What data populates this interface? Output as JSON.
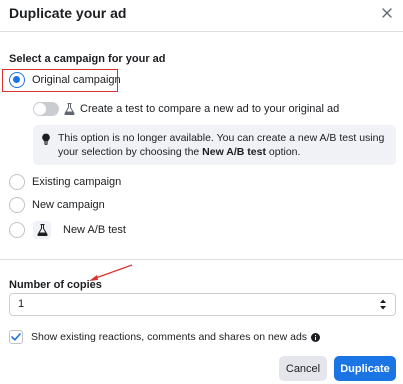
{
  "dialog": {
    "title": "Duplicate your ad",
    "close_icon": "close-icon"
  },
  "campaign": {
    "section_label": "Select a campaign for your ad",
    "options": [
      {
        "label": "Original campaign",
        "selected": true
      },
      {
        "label": "Existing campaign",
        "selected": false
      },
      {
        "label": "New campaign",
        "selected": false
      },
      {
        "label": "New A/B test",
        "selected": false,
        "icon": "flask-icon"
      }
    ],
    "test_toggle": {
      "label": "Create a test to compare a new ad to your original ad",
      "on": false,
      "icon": "flask-icon"
    },
    "info": {
      "icon": "lightbulb-icon",
      "text_before": "This option is no longer available. You can create a new A/B test using your selection by choosing the ",
      "text_bold": "New A/B test",
      "text_after": " option."
    }
  },
  "copies": {
    "label": "Number of copies",
    "value": "1"
  },
  "show_reactions": {
    "label": "Show existing reactions, comments and shares on new ads",
    "checked": true
  },
  "footer": {
    "cancel_label": "Cancel",
    "primary_label": "Duplicate"
  },
  "colors": {
    "accent": "#1b74e4",
    "annotation_red": "#d9312b",
    "info_bg": "#f0f2f5"
  }
}
